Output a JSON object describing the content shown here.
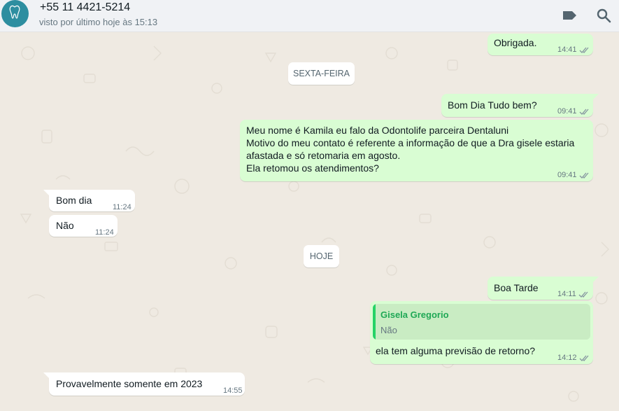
{
  "header": {
    "contact_name": "+55 11 4421-5214",
    "last_seen": "visto por último hoje às 15:13",
    "icons": [
      "label-icon",
      "search-icon"
    ]
  },
  "chat": {
    "messages": [
      {
        "type": "out",
        "text": "Obrigada.",
        "time": "14:41"
      },
      {
        "type": "date",
        "text": "SEXTA-FEIRA"
      },
      {
        "type": "out",
        "text": "Bom Dia Tudo bem?",
        "time": "09:41"
      },
      {
        "type": "out",
        "lines": [
          "Meu nome é Kamila eu falo da Odontolife parceira Dentaluni",
          "Motivo do meu contato é referente a informação de que a Dra gisele estaria",
          "afastada e só retomaria em agosto.",
          "Ela retomou os atendimentos?"
        ],
        "time": "09:41"
      },
      {
        "type": "in",
        "text": "Bom dia",
        "time": "11:24"
      },
      {
        "type": "in",
        "text": "Não",
        "time": "11:24"
      },
      {
        "type": "date",
        "text": "HOJE"
      },
      {
        "type": "out",
        "text": "Boa Tarde",
        "time": "14:11"
      },
      {
        "type": "out",
        "quote_author": "Gisela Gregorio",
        "quote_text": "Não",
        "text": "ela tem alguma previsão de retorno?",
        "time": "14:12"
      },
      {
        "type": "in",
        "text": "Provavelmente somente em 2023",
        "time": "14:55"
      }
    ]
  },
  "colors": {
    "outgoing_bubble": "#d9fdd3",
    "incoming_bubble": "#ffffff",
    "chat_background": "#efeae2",
    "read_ticks": "#8696a0",
    "quote_author": "#1fa855"
  }
}
